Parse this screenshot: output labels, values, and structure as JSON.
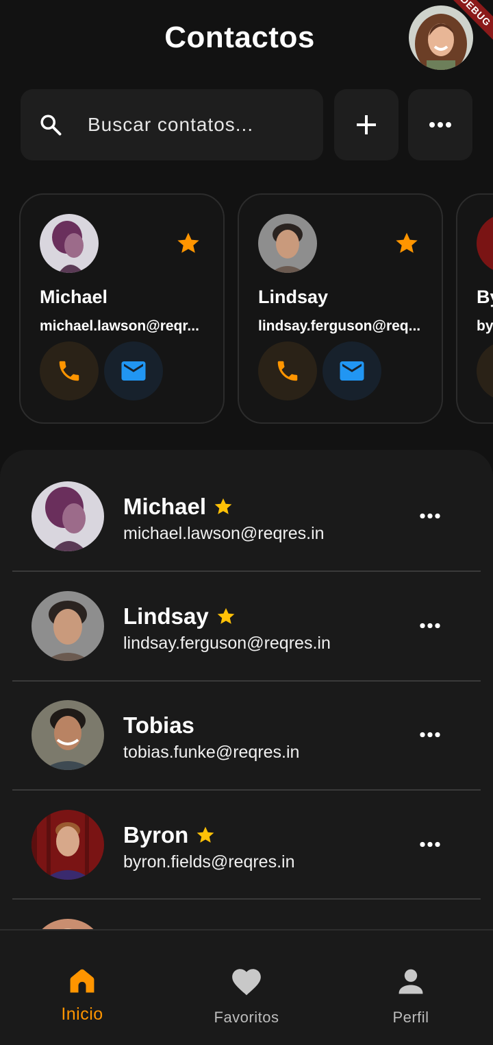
{
  "header": {
    "title": "Contactos",
    "debug_banner": "DEBUG"
  },
  "search": {
    "placeholder": "Buscar contatos..."
  },
  "colors": {
    "accent": "#FF9500",
    "star": "#FFC107",
    "mail": "#2196F3",
    "background": "#121212"
  },
  "favorites": [
    {
      "name": "Michael",
      "email": "michael.lawson@reqr...",
      "starred": true
    },
    {
      "name": "Lindsay",
      "email": "lindsay.ferguson@req...",
      "starred": true
    },
    {
      "name": "By",
      "email": "by",
      "starred": true
    }
  ],
  "contacts": [
    {
      "name": "Michael",
      "email": "michael.lawson@reqres.in",
      "starred": true
    },
    {
      "name": "Lindsay",
      "email": "lindsay.ferguson@reqres.in",
      "starred": true
    },
    {
      "name": "Tobias",
      "email": "tobias.funke@reqres.in",
      "starred": false
    },
    {
      "name": "Byron",
      "email": "byron.fields@reqres.in",
      "starred": true
    }
  ],
  "nav": [
    {
      "label": "Inicio",
      "icon": "home-icon",
      "active": true
    },
    {
      "label": "Favoritos",
      "icon": "heart-icon",
      "active": false
    },
    {
      "label": "Perfil",
      "icon": "person-icon",
      "active": false
    }
  ]
}
